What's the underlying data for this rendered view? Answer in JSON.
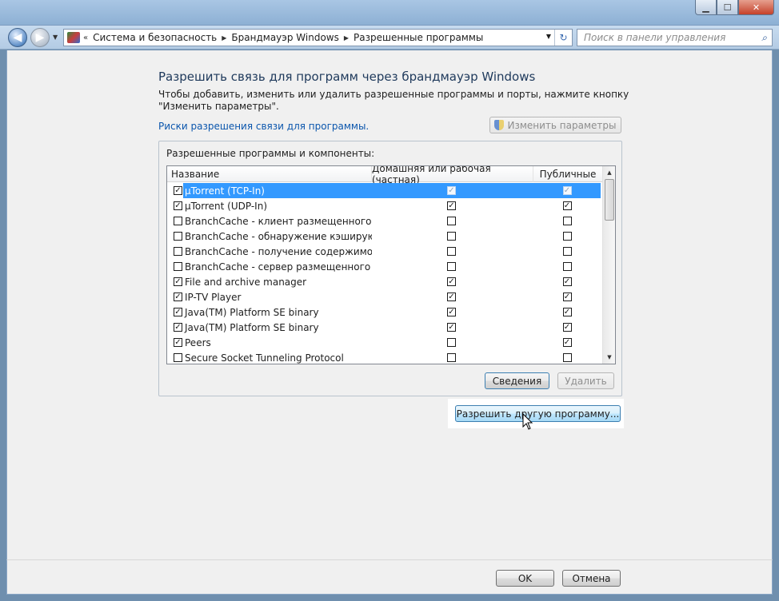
{
  "window": {
    "minimize_glyph": "▁",
    "maximize_glyph": "☐",
    "close_glyph": "✕"
  },
  "nav": {
    "back_glyph": "◀",
    "forward_glyph": "▶",
    "history_glyph": "▼",
    "crumbs_prefix": "«",
    "crumbs": [
      "Система и безопасность",
      "Брандмауэр Windows",
      "Разрешенные программы"
    ],
    "crumb_sep": "▶",
    "dropdown_glyph": "▼",
    "refresh_glyph": "↻",
    "search_placeholder": "Поиск в панели управления",
    "search_glyph": "⌕"
  },
  "main": {
    "title": "Разрешить связь для программ через брандмауэр Windows",
    "description": "Чтобы добавить, изменить или удалить разрешенные программы и порты, нажмите кнопку \"Изменить параметры\".",
    "risk_link": "Риски разрешения связи для программы.",
    "change_settings_button": "Изменить параметры",
    "group_label": "Разрешенные программы и компоненты:",
    "columns": {
      "name": "Название",
      "home": "Домашняя или рабочая (частная)",
      "public": "Публичные"
    },
    "rows": [
      {
        "name": "µTorrent (TCP-In)",
        "enabled": true,
        "home": true,
        "public": true,
        "selected": true
      },
      {
        "name": "µTorrent (UDP-In)",
        "enabled": true,
        "home": true,
        "public": true,
        "selected": false
      },
      {
        "name": "BranchCache - клиент размещенного кэ...",
        "enabled": false,
        "home": false,
        "public": false,
        "selected": false
      },
      {
        "name": "BranchCache - обнаружение кэширующ...",
        "enabled": false,
        "home": false,
        "public": false,
        "selected": false
      },
      {
        "name": "BranchCache - получение содержимого ...",
        "enabled": false,
        "home": false,
        "public": false,
        "selected": false
      },
      {
        "name": "BranchCache - сервер размещенного кэ...",
        "enabled": false,
        "home": false,
        "public": false,
        "selected": false
      },
      {
        "name": "File and archive manager",
        "enabled": true,
        "home": true,
        "public": true,
        "selected": false
      },
      {
        "name": "IP-TV Player",
        "enabled": true,
        "home": true,
        "public": true,
        "selected": false
      },
      {
        "name": "Java(TM) Platform SE binary",
        "enabled": true,
        "home": true,
        "public": true,
        "selected": false
      },
      {
        "name": "Java(TM) Platform SE binary",
        "enabled": true,
        "home": true,
        "public": true,
        "selected": false
      },
      {
        "name": "Peers",
        "enabled": true,
        "home": false,
        "public": true,
        "selected": false
      },
      {
        "name": "Secure Socket Tunneling Protocol",
        "enabled": false,
        "home": false,
        "public": false,
        "selected": false
      }
    ],
    "scroll_up_glyph": "▲",
    "scroll_down_glyph": "▼",
    "details_button": "Сведения",
    "delete_button": "Удалить",
    "allow_other_button": "Разрешить другую программу..."
  },
  "footer": {
    "ok_button": "OK",
    "cancel_button": "Отмена"
  },
  "checkmark_glyph": "✓"
}
